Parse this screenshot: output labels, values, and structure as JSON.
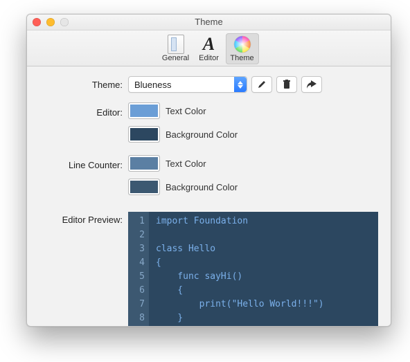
{
  "window": {
    "title": "Theme"
  },
  "toolbar": {
    "items": [
      {
        "label": "General"
      },
      {
        "label": "Editor"
      },
      {
        "label": "Theme"
      }
    ]
  },
  "form": {
    "theme_label": "Theme:",
    "theme_value": "Blueness",
    "editor_label": "Editor:",
    "line_counter_label": "Line Counter:",
    "text_color_label": "Text Color",
    "background_color_label": "Background Color",
    "editor_preview_label": "Editor Preview:"
  },
  "colors": {
    "editor_text": "#6b9ed6",
    "editor_bg": "#2c4760",
    "gutter_text": "#5b7fa3",
    "gutter_bg": "#3c5871",
    "code_text": "#7bb0ea"
  },
  "preview": {
    "lines": [
      "1",
      "2",
      "3",
      "4",
      "5",
      "6",
      "7",
      "8"
    ],
    "code": "import Foundation\n\nclass Hello\n{\n    func sayHi()\n    {\n        print(\"Hello World!!!\")\n    }"
  }
}
